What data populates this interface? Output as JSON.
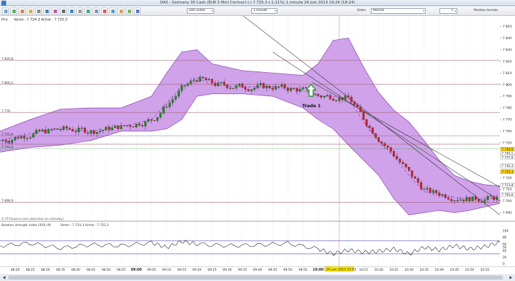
{
  "window": {
    "title": "DAX - Germany 30 Cash (EUR 5 Mini Contract (-) 7 725,3 (-1,11%) 1 minute 24 juin 2013 19:24 (18:24)"
  },
  "toolbar": {
    "unit_select": "200 unités",
    "timeframe_select": "1 minute",
    "order_type_label": "Ordre",
    "order_type_select": "Marché",
    "quantity_value": "1",
    "position_label": "Position fermée"
  },
  "price_panel": {
    "header": "Prix",
    "quote_text": "Vente : 7 724,3  Achat : 7 725,3",
    "footer_credit": "© IT-Finance.com (données en intraday)",
    "annotation": "Trade 1",
    "y_ticks": [
      "7 850",
      "7 840",
      "7 830",
      "7 820",
      "7 810",
      "7 800",
      "7 790",
      "7 780",
      "7 770",
      "7 760",
      "7 750",
      "7 740",
      "7 730",
      "7 720",
      "7 710",
      "7 700",
      "7 690"
    ],
    "level_labels": [
      "7 820,8",
      "7 800,2",
      "7 776",
      "7 755,9",
      "7 748,8",
      "7 744,8",
      "7 698,9"
    ],
    "right_badges": [
      {
        "text": "7 744,5",
        "color": "#ffd400"
      },
      {
        "text": "7 741,1",
        "color": "#ffffff"
      },
      {
        "text": "7 737,6",
        "color": "#ffffff"
      },
      {
        "text": "7 730,3",
        "color": "#ffffff"
      },
      {
        "text": "7 725,3",
        "color": "#ffd400"
      },
      {
        "text": "7 713,8",
        "color": "#ffffff"
      },
      {
        "text": "7 705,6",
        "color": "#ffffff"
      }
    ]
  },
  "rsi_panel": {
    "title": "Relative strength index (RSI) (9)",
    "quote_text": "Vente : 7 724,3  Achat : 7 725,3",
    "y_ticks": [
      "100",
      "80",
      "60",
      "50",
      "40",
      "20",
      "0"
    ],
    "levels": [
      70,
      30
    ]
  },
  "time_axis": {
    "labels": [
      "08:20",
      "08:25",
      "08:30",
      "08:35",
      "08:40",
      "08:45",
      "08:50",
      "08:55",
      "09:00",
      "09:05",
      "09:10",
      "09:15",
      "09:20",
      "09:25",
      "09:30",
      "09:35",
      "09:40",
      "09:45",
      "09:50",
      "09:55",
      "10:00",
      "10:05",
      "10:10",
      "10:15",
      "10:20",
      "10:25",
      "10:30",
      "10:35",
      "10:40",
      "10:45",
      "10:50",
      "10:55"
    ],
    "bold_labels": [
      "09:00",
      "10:00"
    ],
    "cursor_label": "24 juin 2013 10:03"
  },
  "colors": {
    "band_fill": "#cfa2ea",
    "band_line": "#8a3fb0",
    "candle_up": "#1a8f1a",
    "candle_down": "#d02020",
    "trend_line": "#333333",
    "rsi_line": "#222222",
    "rsi_overbought": "#c07070",
    "rsi_oversold": "#5fa35f",
    "level_line": "#a06070",
    "arrow": "#1e9e1e"
  },
  "chart_data": {
    "type": "candlestick",
    "title": "DAX - Germany 30 Cash (EUR 5 Mini Contract (-)",
    "timeframe": "1 minute",
    "date": "24 juin 2013",
    "x_range": [
      "08:15",
      "11:00"
    ],
    "ylim": [
      7685,
      7855
    ],
    "bollinger": {
      "time": [
        "08:15",
        "08:25",
        "08:35",
        "08:45",
        "08:55",
        "09:05",
        "09:10",
        "09:15",
        "09:20",
        "09:25",
        "09:35",
        "09:45",
        "09:55",
        "10:00",
        "10:05",
        "10:10",
        "10:15",
        "10:20",
        "10:25",
        "10:30",
        "10:35",
        "10:40",
        "10:45",
        "10:50",
        "10:55",
        "11:00"
      ],
      "upper": [
        7760,
        7770,
        7779,
        7780,
        7780,
        7790,
        7810,
        7828,
        7830,
        7818,
        7812,
        7810,
        7808,
        7818,
        7838,
        7840,
        7815,
        7793,
        7778,
        7768,
        7752,
        7735,
        7722,
        7717,
        7714,
        7713
      ],
      "middle": [
        7752,
        7758,
        7762,
        7760,
        7764,
        7770,
        7784,
        7798,
        7806,
        7800,
        7798,
        7798,
        7795,
        7790,
        7790,
        7788,
        7768,
        7752,
        7738,
        7722,
        7708,
        7706,
        7703,
        7702,
        7702,
        7703
      ],
      "lower": [
        7742,
        7746,
        7748,
        7752,
        7760,
        7760,
        7762,
        7770,
        7790,
        7792,
        7792,
        7790,
        7780,
        7770,
        7762,
        7748,
        7735,
        7722,
        7702,
        7688,
        7690,
        7692,
        7690,
        7692,
        7695,
        7698
      ]
    },
    "levels": [
      7820.8,
      7800.2,
      7776,
      7755.9,
      7748.8,
      7744.8,
      7698.9
    ],
    "last_price": 7725.3,
    "rsi": {
      "time": [
        "08:15",
        "08:25",
        "08:35",
        "08:45",
        "08:55",
        "09:05",
        "09:10",
        "09:15",
        "09:20",
        "09:30",
        "09:40",
        "09:50",
        "10:00",
        "10:05",
        "10:10",
        "10:15",
        "10:20",
        "10:25",
        "10:30",
        "10:35",
        "10:40",
        "10:45",
        "10:50",
        "10:55",
        "11:00"
      ],
      "values": [
        55,
        62,
        48,
        58,
        55,
        64,
        50,
        68,
        60,
        55,
        57,
        62,
        45,
        30,
        42,
        35,
        38,
        45,
        30,
        50,
        42,
        55,
        45,
        52,
        65
      ]
    }
  }
}
